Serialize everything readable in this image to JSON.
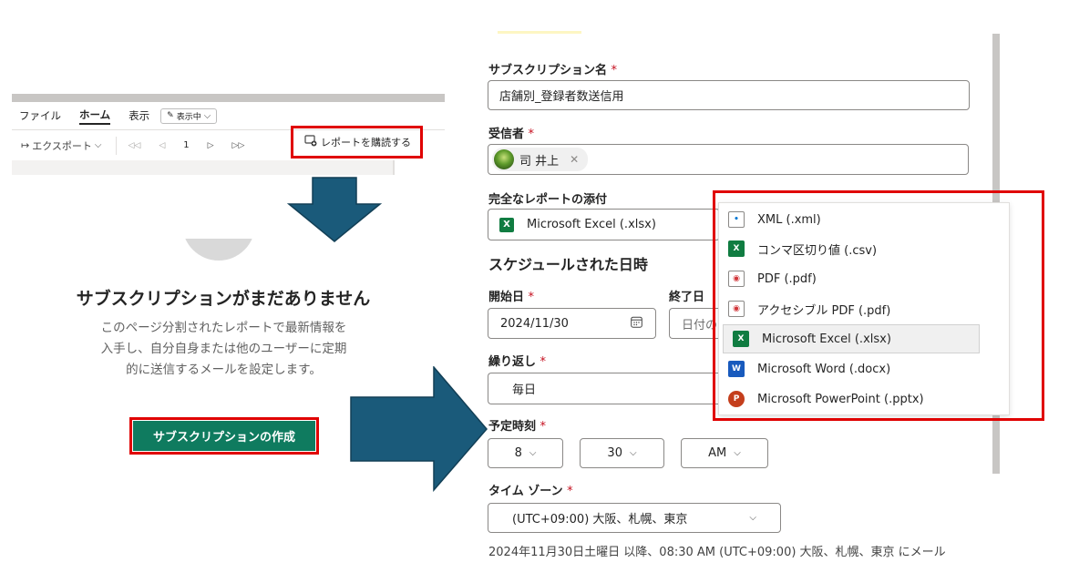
{
  "ribbon": {
    "tabs": [
      "ファイル",
      "ホーム",
      "表示"
    ],
    "view_mode": "表示中",
    "export_label": "エクスポート",
    "page_number": "1",
    "subscribe_label": "レポートを購読する"
  },
  "empty_state": {
    "title": "サブスクリプションがまだありません",
    "description": "このページ分割されたレポートで最新情報を入手し、自分自身または他のユーザーに定期的に送信するメールを設定します。",
    "create_button": "サブスクリプションの作成"
  },
  "form": {
    "subscription_name": {
      "label": "サブスクリプション名",
      "value": "店舗別_登録者数送信用"
    },
    "recipients": {
      "label": "受信者",
      "person": "司 井上"
    },
    "attachment": {
      "label": "完全なレポートの添付",
      "value": "Microsoft Excel (.xlsx)"
    },
    "schedule_title": "スケジュールされた日時",
    "start_date": {
      "label": "開始日",
      "value": "2024/11/30"
    },
    "end_date": {
      "label": "終了日",
      "placeholder": "日付の"
    },
    "repeat": {
      "label": "繰り返し",
      "value": "毎日"
    },
    "scheduled_time": {
      "label": "予定時刻",
      "hour": "8",
      "minute": "30",
      "ampm": "AM"
    },
    "timezone": {
      "label": "タイム ゾーン",
      "value": "(UTC+09:00) 大阪、札幌、東京"
    },
    "summary": "2024年11月30日土曜日 以降、08:30 AM (UTC+09:00) 大阪、札幌、東京 にメール"
  },
  "format_menu": {
    "items": [
      {
        "label": "XML (.xml)",
        "icon": "xml-file-icon"
      },
      {
        "label": "コンマ区切り値 (.csv)",
        "icon": "csv-file-icon"
      },
      {
        "label": "PDF (.pdf)",
        "icon": "pdf-file-icon"
      },
      {
        "label": "アクセシブル PDF (.pdf)",
        "icon": "accessible-pdf-file-icon"
      },
      {
        "label": "Microsoft Excel (.xlsx)",
        "icon": "excel-icon",
        "selected": true
      },
      {
        "label": "Microsoft Word (.docx)",
        "icon": "word-icon"
      },
      {
        "label": "Microsoft PowerPoint (.pptx)",
        "icon": "powerpoint-icon"
      }
    ]
  },
  "colors": {
    "highlight": "#e00000",
    "arrow": "#1a5a7a",
    "primary_button": "#0f7b5f",
    "required": "#c50f1f"
  }
}
